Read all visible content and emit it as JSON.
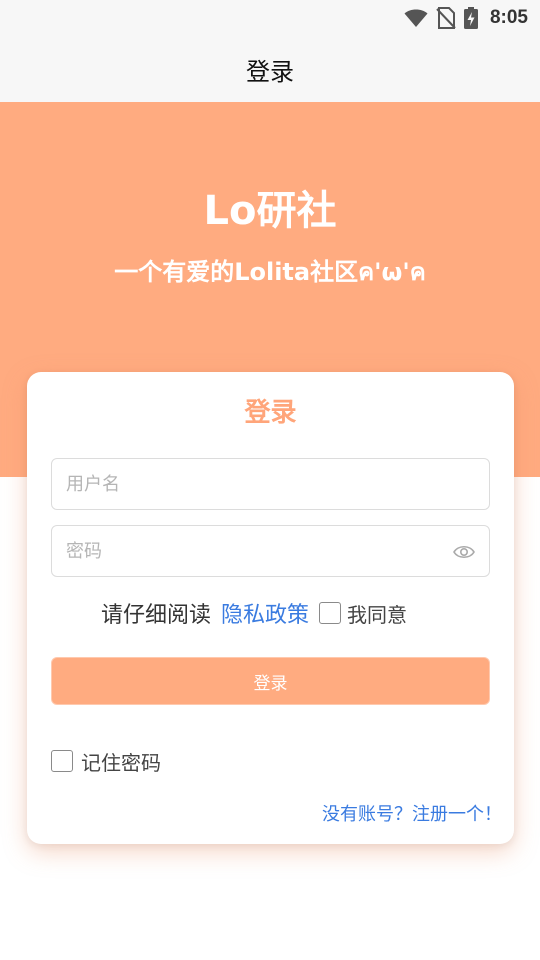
{
  "status_bar": {
    "time": "8:05",
    "icons": [
      "wifi-icon",
      "no-sim-icon",
      "battery-charging-icon"
    ]
  },
  "app_bar": {
    "title": "登录"
  },
  "hero": {
    "title": "Lo研社",
    "subtitle": "一个有爱的Lolita社区ค'ω'ค",
    "color": "#ffab80"
  },
  "login_card": {
    "title": "登录",
    "username_placeholder": "用户名",
    "password_placeholder": "密码",
    "agreement_text": "请仔细阅读",
    "privacy_link": "隐私政策",
    "agree_label": "我同意",
    "login_button": "登录",
    "remember_label": "记住密码",
    "register_link": "没有账号？注册一个！"
  },
  "colors": {
    "accent": "#ffab80",
    "link": "#3a7be0"
  }
}
